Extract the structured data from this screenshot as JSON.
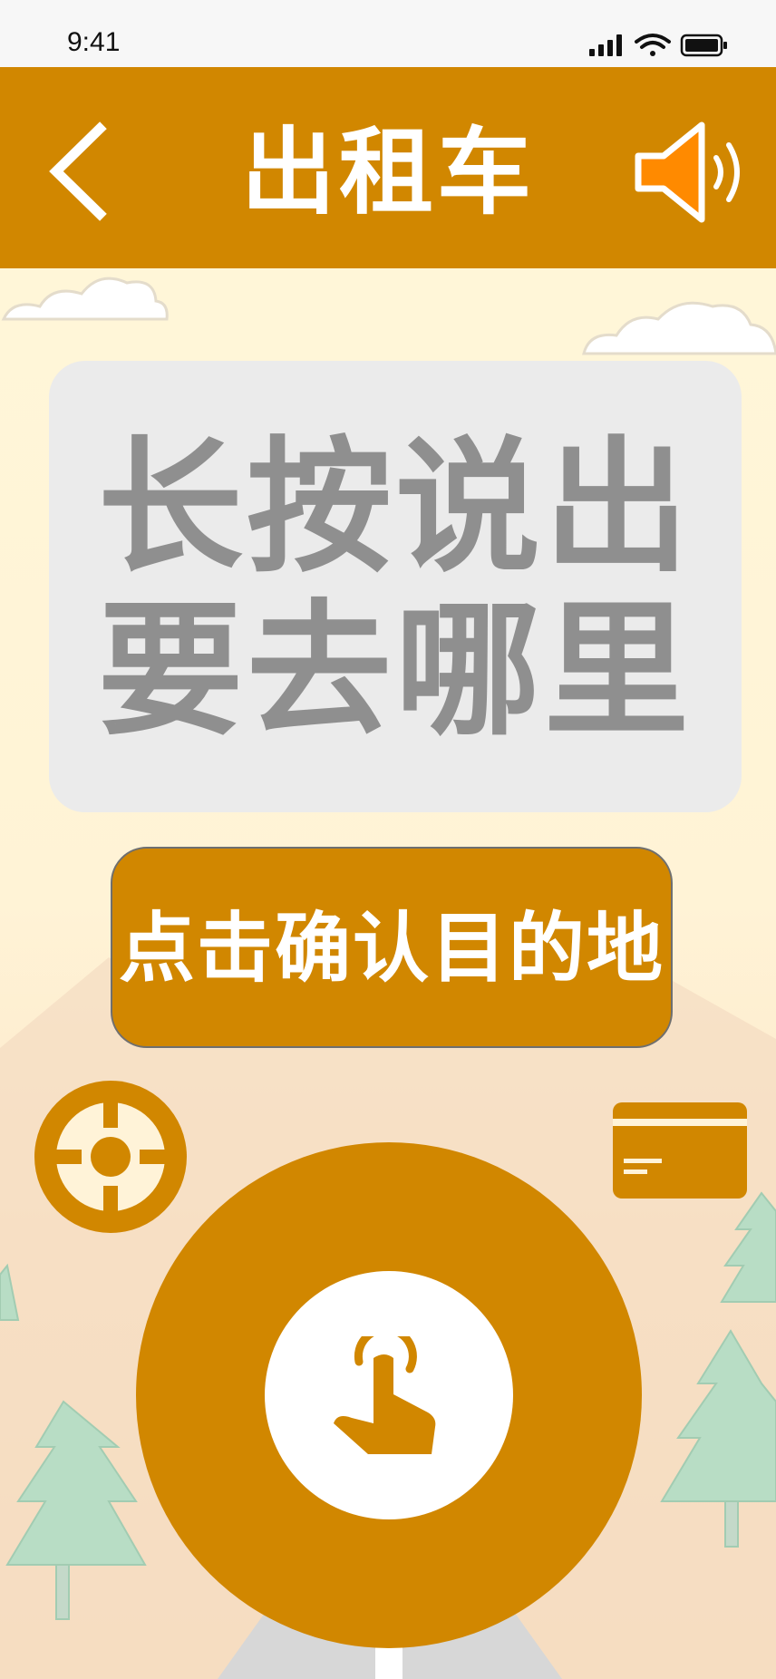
{
  "status_bar": {
    "time": "9:41",
    "icons": [
      "signal-icon",
      "wifi-icon",
      "battery-icon"
    ]
  },
  "header": {
    "title": "出租车",
    "back_icon": "chevron-left-icon",
    "sound_icon": "speaker-icon"
  },
  "prompt": {
    "line1": "长按说出",
    "line2": "要去哪里"
  },
  "confirm_button": {
    "label": "点击确认目的地"
  },
  "actions": {
    "locate_icon": "crosshair-icon",
    "card_icon": "card-icon",
    "talk_icon": "hand-pointer-icon"
  },
  "colors": {
    "accent": "#d18700",
    "speaker": "#ff8a00",
    "card_bg": "#ebebeb",
    "prompt_text": "#8f8f8f",
    "scene_bg": "#fff6d8"
  }
}
